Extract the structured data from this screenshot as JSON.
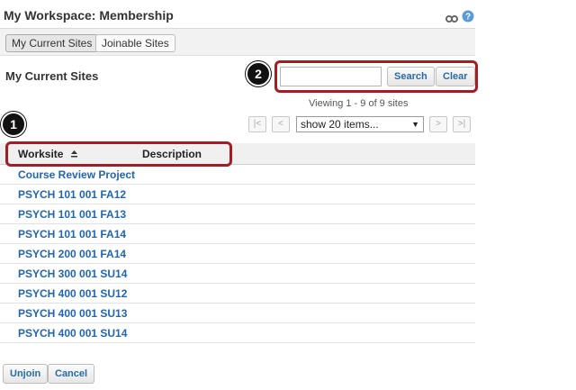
{
  "header": {
    "title": "My Workspace: Membership",
    "icons": [
      "link-icon",
      "help-icon"
    ]
  },
  "tabs": [
    {
      "label": "My Current Sites",
      "active": true
    },
    {
      "label": "Joinable Sites",
      "active": false
    }
  ],
  "section_title": "My Current Sites",
  "search": {
    "value": "",
    "search_label": "Search",
    "clear_label": "Clear"
  },
  "callouts": [
    "1",
    "2"
  ],
  "viewing": "Viewing 1 - 9 of 9 sites",
  "pager": {
    "first": "|<",
    "prev": "<",
    "next": ">",
    "last": ">|",
    "page_size": "show 20 items..."
  },
  "table": {
    "columns": [
      "Worksite",
      "Description"
    ],
    "rows": [
      "Course Review Project",
      "PSYCH 101 001 FA12",
      "PSYCH 101 001 FA13",
      "PSYCH 101 001 FA14",
      "PSYCH 200 001 FA14",
      "PSYCH 300 001 SU14",
      "PSYCH 400 001 SU12",
      "PSYCH 400 001 SU13",
      "PSYCH 400 001 SU14"
    ]
  },
  "actions": {
    "unjoin_label": "Unjoin",
    "cancel_label": "Cancel"
  },
  "colors": {
    "link": "#2265b0",
    "highlight": "#a41c24"
  }
}
